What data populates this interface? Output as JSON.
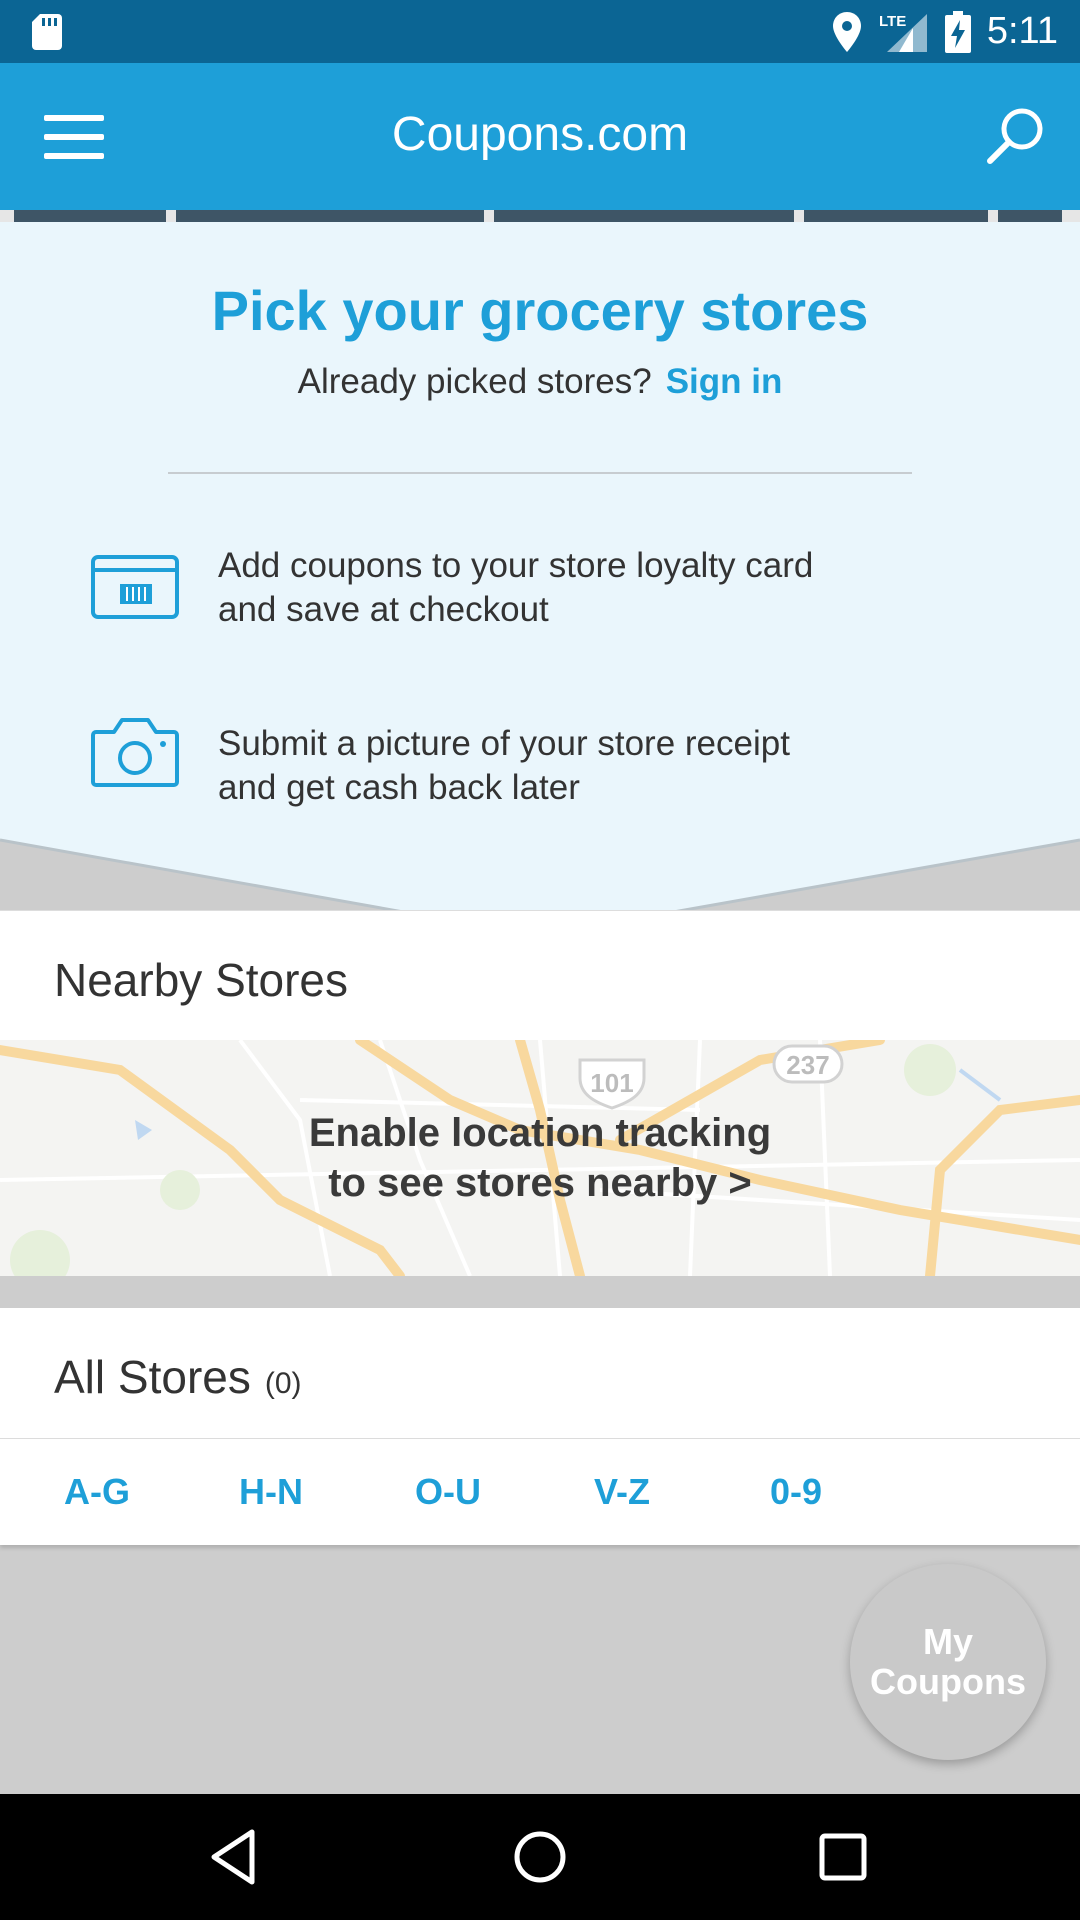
{
  "status": {
    "network": "LTE",
    "time": "5:11"
  },
  "appbar": {
    "title": "Coupons.com"
  },
  "hero": {
    "heading": "Pick your grocery stores",
    "subtext": "Already picked stores?",
    "signin_label": "Sign in",
    "feature1_line1": "Add coupons to your store loyalty card",
    "feature1_line2": "and save at checkout",
    "feature2_line1": "Submit a picture of your store receipt",
    "feature2_line2": "and get cash back later"
  },
  "nearby": {
    "label": "Nearby Stores",
    "cta_line1": "Enable location tracking",
    "cta_line2": "to see stores nearby >",
    "map_shields": [
      "101",
      "237"
    ]
  },
  "allstores": {
    "label": "All Stores",
    "count": "(0)",
    "tabs": [
      "A-G",
      "H-N",
      "O-U",
      "V-Z",
      "0-9"
    ]
  },
  "fab": {
    "line1": "My",
    "line2": "Coupons"
  },
  "colors": {
    "brand": "#1e9fd8",
    "status_bar": "#0b6594",
    "hero_bg": "#eaf6fc"
  },
  "icons": [
    "sd-card-icon",
    "location-icon",
    "signal-icon",
    "battery-charging-icon",
    "menu-icon",
    "search-icon",
    "loyalty-card-icon",
    "camera-icon",
    "back-icon",
    "home-icon",
    "recents-icon"
  ]
}
